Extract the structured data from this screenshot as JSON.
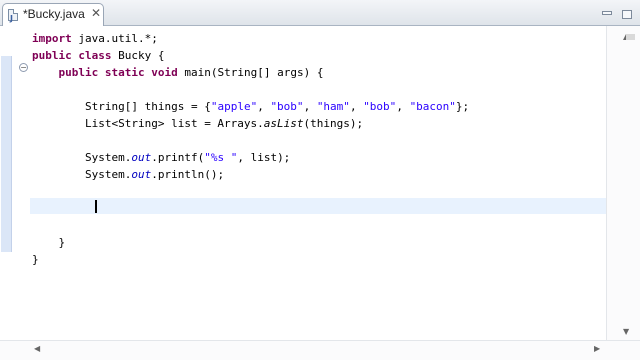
{
  "tab": {
    "label": "*Bucky.java",
    "close_glyph": "✕",
    "icon_glyph": "J"
  },
  "window": {
    "minimize_glyph": "",
    "maximize_glyph": ""
  },
  "gutter": {
    "fold_glyph": "−"
  },
  "scrollbars": {
    "up": "▲",
    "down": "▼",
    "left": "◀",
    "right": "▶"
  },
  "code": {
    "line1": {
      "kw": "import",
      "rest": " java.util.*;"
    },
    "line2": {
      "kw1": "public",
      "kw2": "class",
      "rest": " Bucky {"
    },
    "line3": {
      "kw1": "public",
      "kw2": "static",
      "kw3": "void",
      "rest": " main(String[] args) {"
    },
    "line5": {
      "pre": "String[] things = {",
      "s1": "\"apple\"",
      "s2": "\"bob\"",
      "s3": "\"ham\"",
      "s4": "\"bob\"",
      "s5": "\"bacon\"",
      "sep": ", ",
      "post": "};"
    },
    "line6": {
      "pre": "List<String> list = Arrays.",
      "method": "asList",
      "post": "(things);"
    },
    "line8": {
      "pre": "System.",
      "field": "out",
      "mid": ".printf(",
      "str": "\"%s \"",
      "post": ", list);"
    },
    "line9": {
      "pre": "System.",
      "field": "out",
      "post": ".println();"
    },
    "line13": "}",
    "line14": "}"
  }
}
